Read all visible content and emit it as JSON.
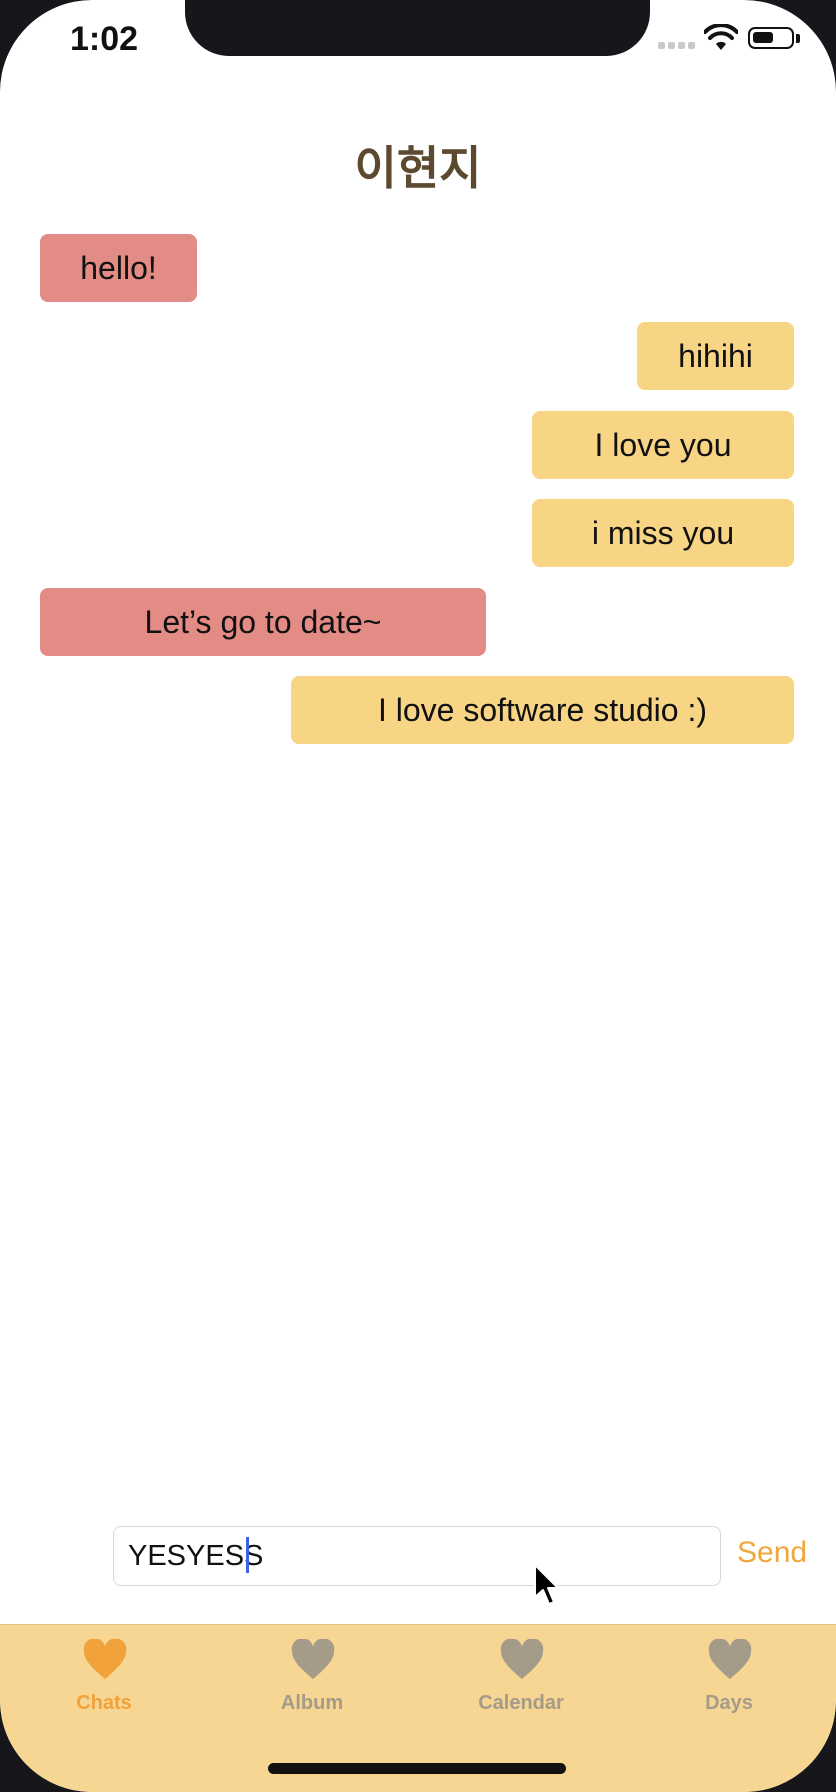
{
  "status_bar": {
    "time": "1:02",
    "battery_level": 0.55
  },
  "header": {
    "title": "이현지"
  },
  "messages": [
    {
      "text": "hello!",
      "direction": "received"
    },
    {
      "text": "hihihi",
      "direction": "sent"
    },
    {
      "text": "I love you",
      "direction": "sent"
    },
    {
      "text": "i miss you",
      "direction": "sent"
    },
    {
      "text": "Let’s go to date~",
      "direction": "received"
    },
    {
      "text": "I love software studio :)",
      "direction": "sent"
    }
  ],
  "composer": {
    "value": "YESYESS",
    "send_label": "Send"
  },
  "tabs": [
    {
      "label": "Chats",
      "icon": "heart-icon",
      "active": true
    },
    {
      "label": "Album",
      "icon": "heart-icon",
      "active": false
    },
    {
      "label": "Calendar",
      "icon": "heart-icon",
      "active": false
    },
    {
      "label": "Days",
      "icon": "heart-icon",
      "active": false
    }
  ],
  "colors": {
    "received_bubble": "#e38b85",
    "sent_bubble": "#f8d585",
    "tab_bar": "#f6d692",
    "accent": "#f0a83c",
    "tab_active": "#f2a23b",
    "tab_inactive": "#a59b89",
    "title": "#5c4a30"
  }
}
